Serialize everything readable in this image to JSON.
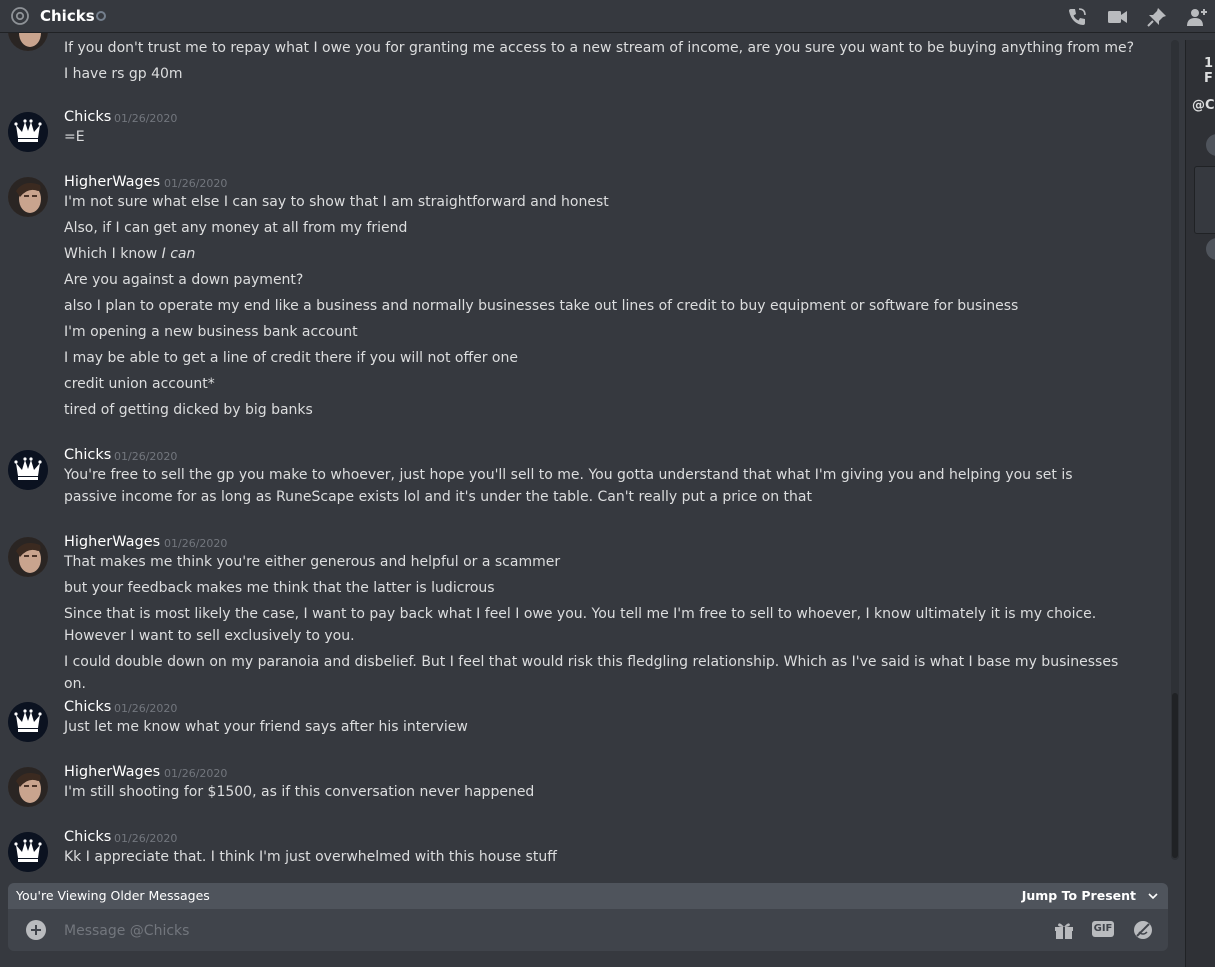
{
  "header": {
    "channel_name": "Chicks",
    "icons": [
      "at-icon",
      "status-dot",
      "voice-call-icon",
      "video-call-icon",
      "pin-icon",
      "add-friend-icon"
    ]
  },
  "messages": [
    {
      "type": "continuation",
      "lines": [
        "If you don't trust me to repay what I owe you for granting me access to a new stream of income, are you sure you want to be buying anything from me?",
        "I have rs gp 40m"
      ]
    },
    {
      "type": "group",
      "author": "Chicks",
      "timestamp": "01/26/2020",
      "avatar": "crown",
      "lines": [
        "=E"
      ]
    },
    {
      "type": "group",
      "author": "HigherWages",
      "timestamp": "01/26/2020",
      "avatar": "face",
      "lines": [
        "I'm not sure what else I can say to show that I am straightforward and honest",
        "Also, if I can get any money at all from my friend",
        "Which I know",
        "Are you against a down payment?",
        "also I plan to operate my end like a business and normally businesses take out lines of credit to buy equipment or software for business",
        "I'm opening a new business bank account",
        "I may be able to get a line of credit there if you will not offer one",
        "credit union account*",
        "tired of getting dicked by big banks"
      ]
    },
    {
      "type": "group",
      "author": "Chicks",
      "timestamp": "01/26/2020",
      "avatar": "crown",
      "lines": [
        "You're free to sell the gp you make to whoever, just hope you'll sell to me. You gotta understand that what I'm giving you and helping you set is passive income for as long as RuneScape exists lol and it's under the table. Can't really put a price on that"
      ]
    },
    {
      "type": "group",
      "author": "HigherWages",
      "timestamp": "01/26/2020",
      "avatar": "face",
      "lines": [
        "That makes me think you're either generous and helpful or a scammer",
        "but your feedback makes me think that the latter is ludicrous",
        "Since that is most likely the case, I want to pay back what I feel I owe you. You tell me I'm free to sell to whoever, I know ultimately it is my choice. However I want to sell exclusively to you.",
        "I could double down on my paranoia and disbelief. But I feel that would risk this fledgling relationship. Which as I've said is what I base my businesses on."
      ]
    },
    {
      "type": "group",
      "author": "Chicks",
      "timestamp": "01/26/2020",
      "avatar": "crown",
      "lines": [
        "Just let me know what your friend says after his interview"
      ]
    },
    {
      "type": "group",
      "author": "HigherWages",
      "timestamp": "01/26/2020",
      "avatar": "face",
      "lines": [
        "I'm still shooting for $1500, as if this conversation never happened"
      ]
    },
    {
      "type": "group",
      "author": "Chicks",
      "timestamp": "01/26/2020",
      "avatar": "crown",
      "lines": [
        "Kk I appreciate that. I think I'm just overwhelmed with this house stuff"
      ]
    }
  ],
  "italic_fragment": "I can",
  "right_panel": {
    "top_text": "1 F",
    "mention_text": "@C"
  },
  "older_banner": {
    "text": "You're Viewing Older Messages",
    "jump_label": "Jump To Present"
  },
  "composer": {
    "placeholder": "Message @Chicks",
    "gif_label": "GIF"
  }
}
